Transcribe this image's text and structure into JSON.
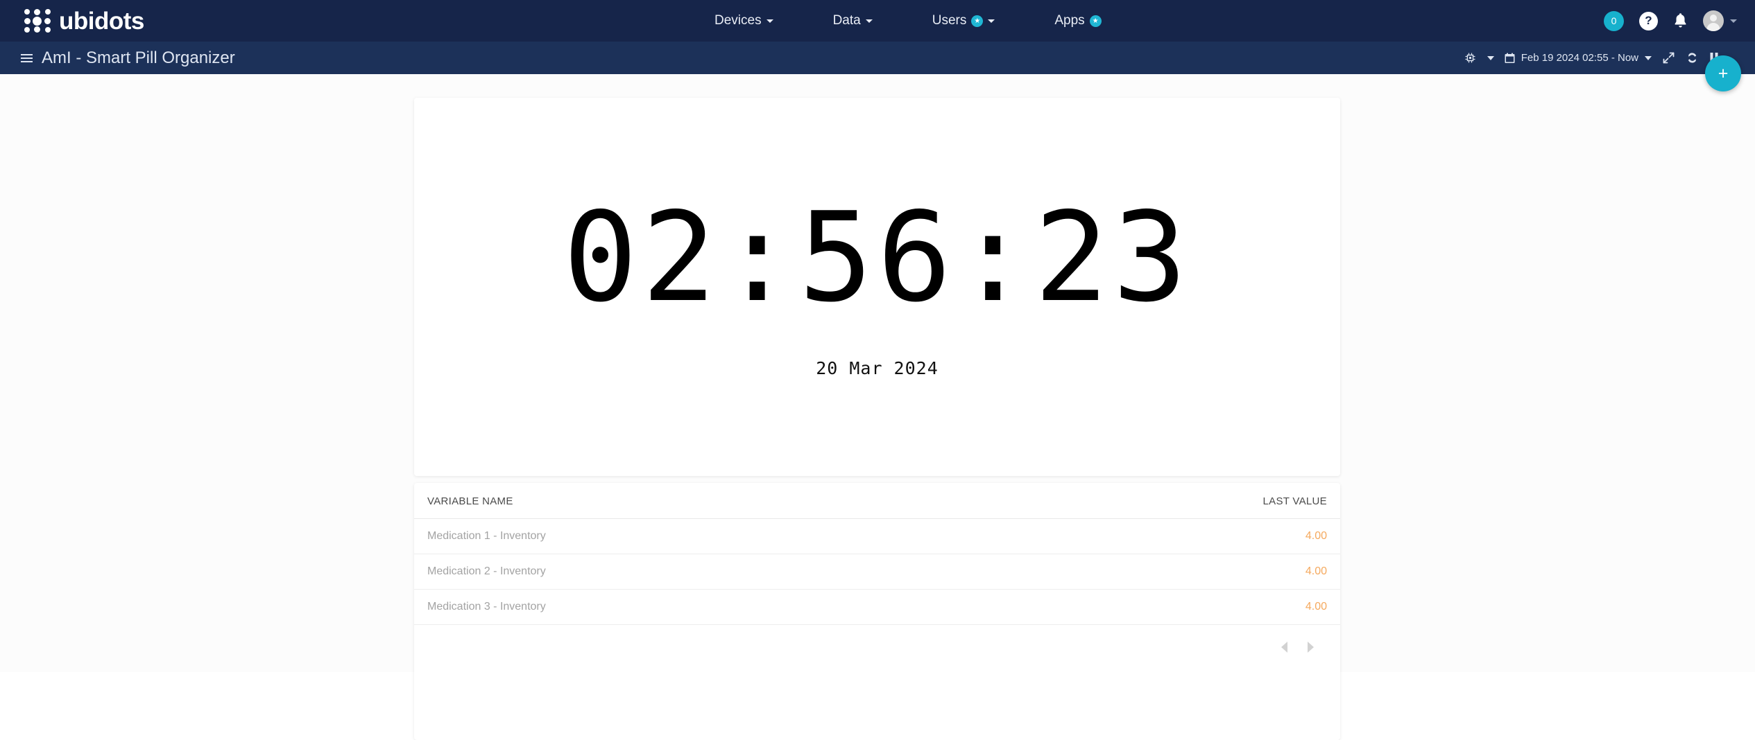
{
  "brand": {
    "name": "ubidots",
    "logo_icon": "ubidots-dots-logo"
  },
  "navbar": {
    "items": [
      {
        "label": "Devices",
        "has_caret": true,
        "badge": null
      },
      {
        "label": "Data",
        "has_caret": true,
        "badge": null
      },
      {
        "label": "Users",
        "has_caret": true,
        "badge": "star-icon"
      },
      {
        "label": "Apps",
        "has_caret": false,
        "badge": "star-icon"
      }
    ],
    "notifications_count": "0",
    "help_label": "?",
    "bell_icon": "bell-icon",
    "avatar_icon": "user-avatar-icon"
  },
  "subbar": {
    "dashboard_title": "AmI - Smart Pill Organizer",
    "menu_icon": "hamburger-icon",
    "device_icon": "chip-icon",
    "calendar_icon": "calendar-icon",
    "date_range": "Feb 19 2024 02:55 - Now",
    "fullscreen_icon": "expand-arrows-icon",
    "refresh_icon": "refresh-icon",
    "pause_icon": "pause-icon"
  },
  "fab": {
    "label": "+",
    "icon": "plus-icon"
  },
  "clock_widget": {
    "time": "02:56:23",
    "date": "20 Mar 2024"
  },
  "table_widget": {
    "columns": [
      "VARIABLE NAME",
      "LAST VALUE"
    ],
    "rows": [
      {
        "name": "Medication 1 - Inventory",
        "value": "4.00"
      },
      {
        "name": "Medication 2 - Inventory",
        "value": "4.00"
      },
      {
        "name": "Medication 3 - Inventory",
        "value": "4.00"
      }
    ],
    "pagination": {
      "prev_icon": "triangle-left-icon",
      "next_icon": "triangle-right-icon"
    }
  },
  "colors": {
    "navbar_bg": "#16254a",
    "subbar_bg": "#1c3159",
    "accent_cyan": "#17b1cd",
    "value_orange": "#f5a95e",
    "page_bg": "#fcfcfc"
  }
}
